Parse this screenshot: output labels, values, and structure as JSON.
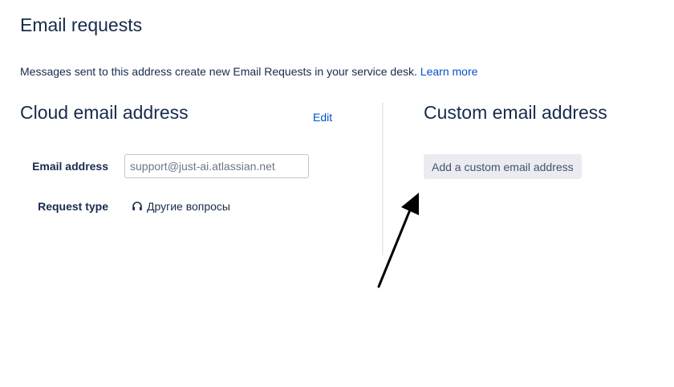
{
  "page": {
    "title": "Email requests",
    "intro_text": "Messages sent to this address create new Email Requests in your service desk. ",
    "learn_more_label": "Learn more"
  },
  "cloud": {
    "title": "Cloud email address",
    "edit_label": "Edit",
    "email_label": "Email address",
    "email_value": "support@just-ai.atlassian.net",
    "request_type_label": "Request type",
    "request_type_value": "Другие вопросы",
    "request_type_icon": "headset-icon"
  },
  "custom": {
    "title": "Custom email address",
    "add_button_label": "Add a custom email address"
  },
  "annotation": {
    "icon": "arrow-annotation-icon",
    "color": "#000000"
  },
  "colors": {
    "text": "#172B4D",
    "link": "#0052CC",
    "button_bg": "#EBECF0",
    "button_text": "#42526E",
    "input_border": "#C1C7D0",
    "divider": "#EBECF0"
  }
}
